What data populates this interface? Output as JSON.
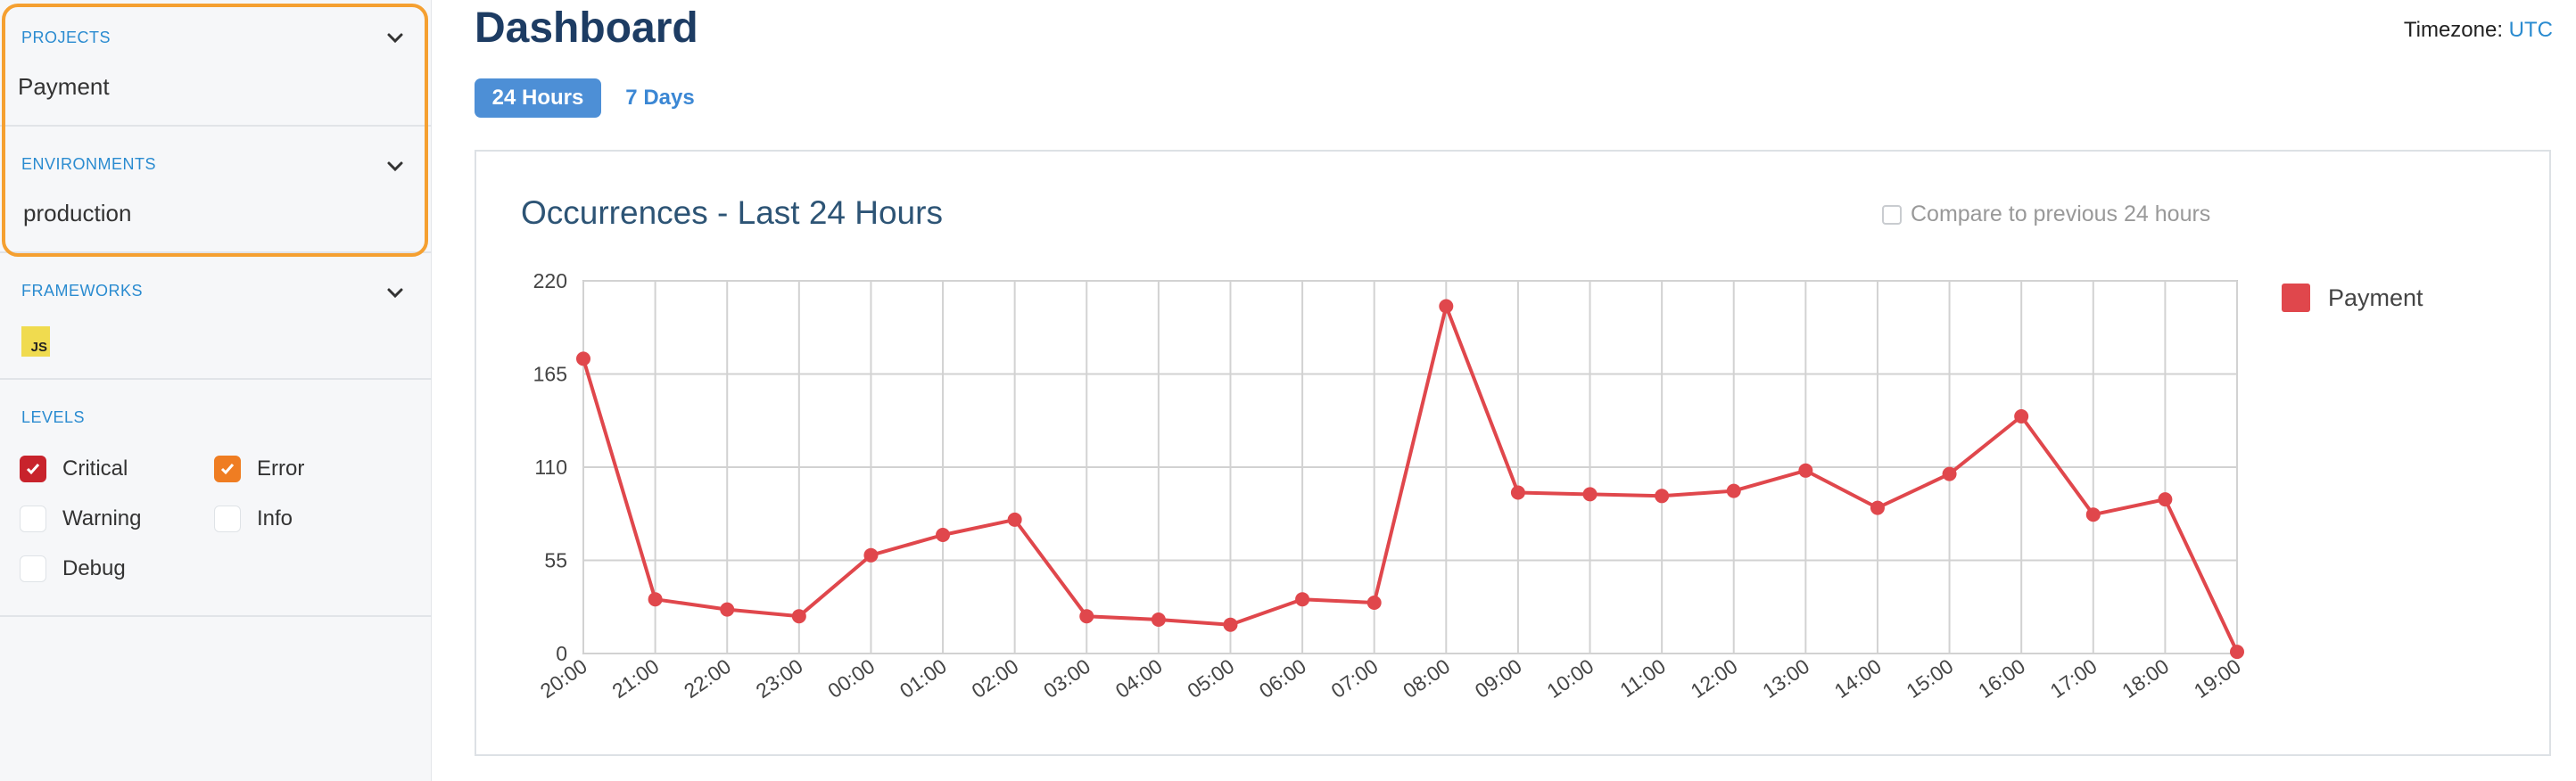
{
  "sidebar": {
    "projects": {
      "title": "PROJECTS",
      "value": "Payment"
    },
    "environments": {
      "title": "ENVIRONMENTS",
      "value": "production"
    },
    "frameworks": {
      "title": "FRAMEWORKS",
      "badge": "JS",
      "badge_icon": "javascript-icon"
    },
    "levels": {
      "title": "LEVELS",
      "items": [
        {
          "label": "Critical",
          "checked": true,
          "color": "#c8232c"
        },
        {
          "label": "Error",
          "checked": true,
          "color": "#ef7d22"
        },
        {
          "label": "Warning",
          "checked": false
        },
        {
          "label": "Info",
          "checked": false
        },
        {
          "label": "Debug",
          "checked": false
        }
      ]
    }
  },
  "header": {
    "title": "Dashboard",
    "timezone_label": "Timezone:",
    "timezone_value": "UTC"
  },
  "tabs": [
    {
      "label": "24 Hours",
      "active": true
    },
    {
      "label": "7 Days",
      "active": false
    }
  ],
  "card": {
    "title": "Occurrences - Last 24 Hours",
    "compare_label": "Compare to previous 24 hours",
    "compare_checked": false
  },
  "colors": {
    "accent": "#4d8fd6",
    "highlight": "#f5a031",
    "series": "#e0474c"
  },
  "chart_data": {
    "type": "line",
    "x": [
      "20:00",
      "21:00",
      "22:00",
      "23:00",
      "00:00",
      "01:00",
      "02:00",
      "03:00",
      "04:00",
      "05:00",
      "06:00",
      "07:00",
      "08:00",
      "09:00",
      "10:00",
      "11:00",
      "12:00",
      "13:00",
      "14:00",
      "15:00",
      "16:00",
      "17:00",
      "18:00",
      "19:00"
    ],
    "series": [
      {
        "name": "Payment",
        "color": "#e0474c",
        "values": [
          174,
          32,
          26,
          22,
          58,
          70,
          79,
          22,
          20,
          17,
          32,
          30,
          205,
          95,
          94,
          93,
          96,
          108,
          86,
          106,
          140,
          82,
          91,
          1
        ]
      }
    ],
    "yticks": [
      0,
      55,
      110,
      165,
      220
    ],
    "ylim": [
      0,
      220
    ],
    "grid": true,
    "legend": "right"
  }
}
